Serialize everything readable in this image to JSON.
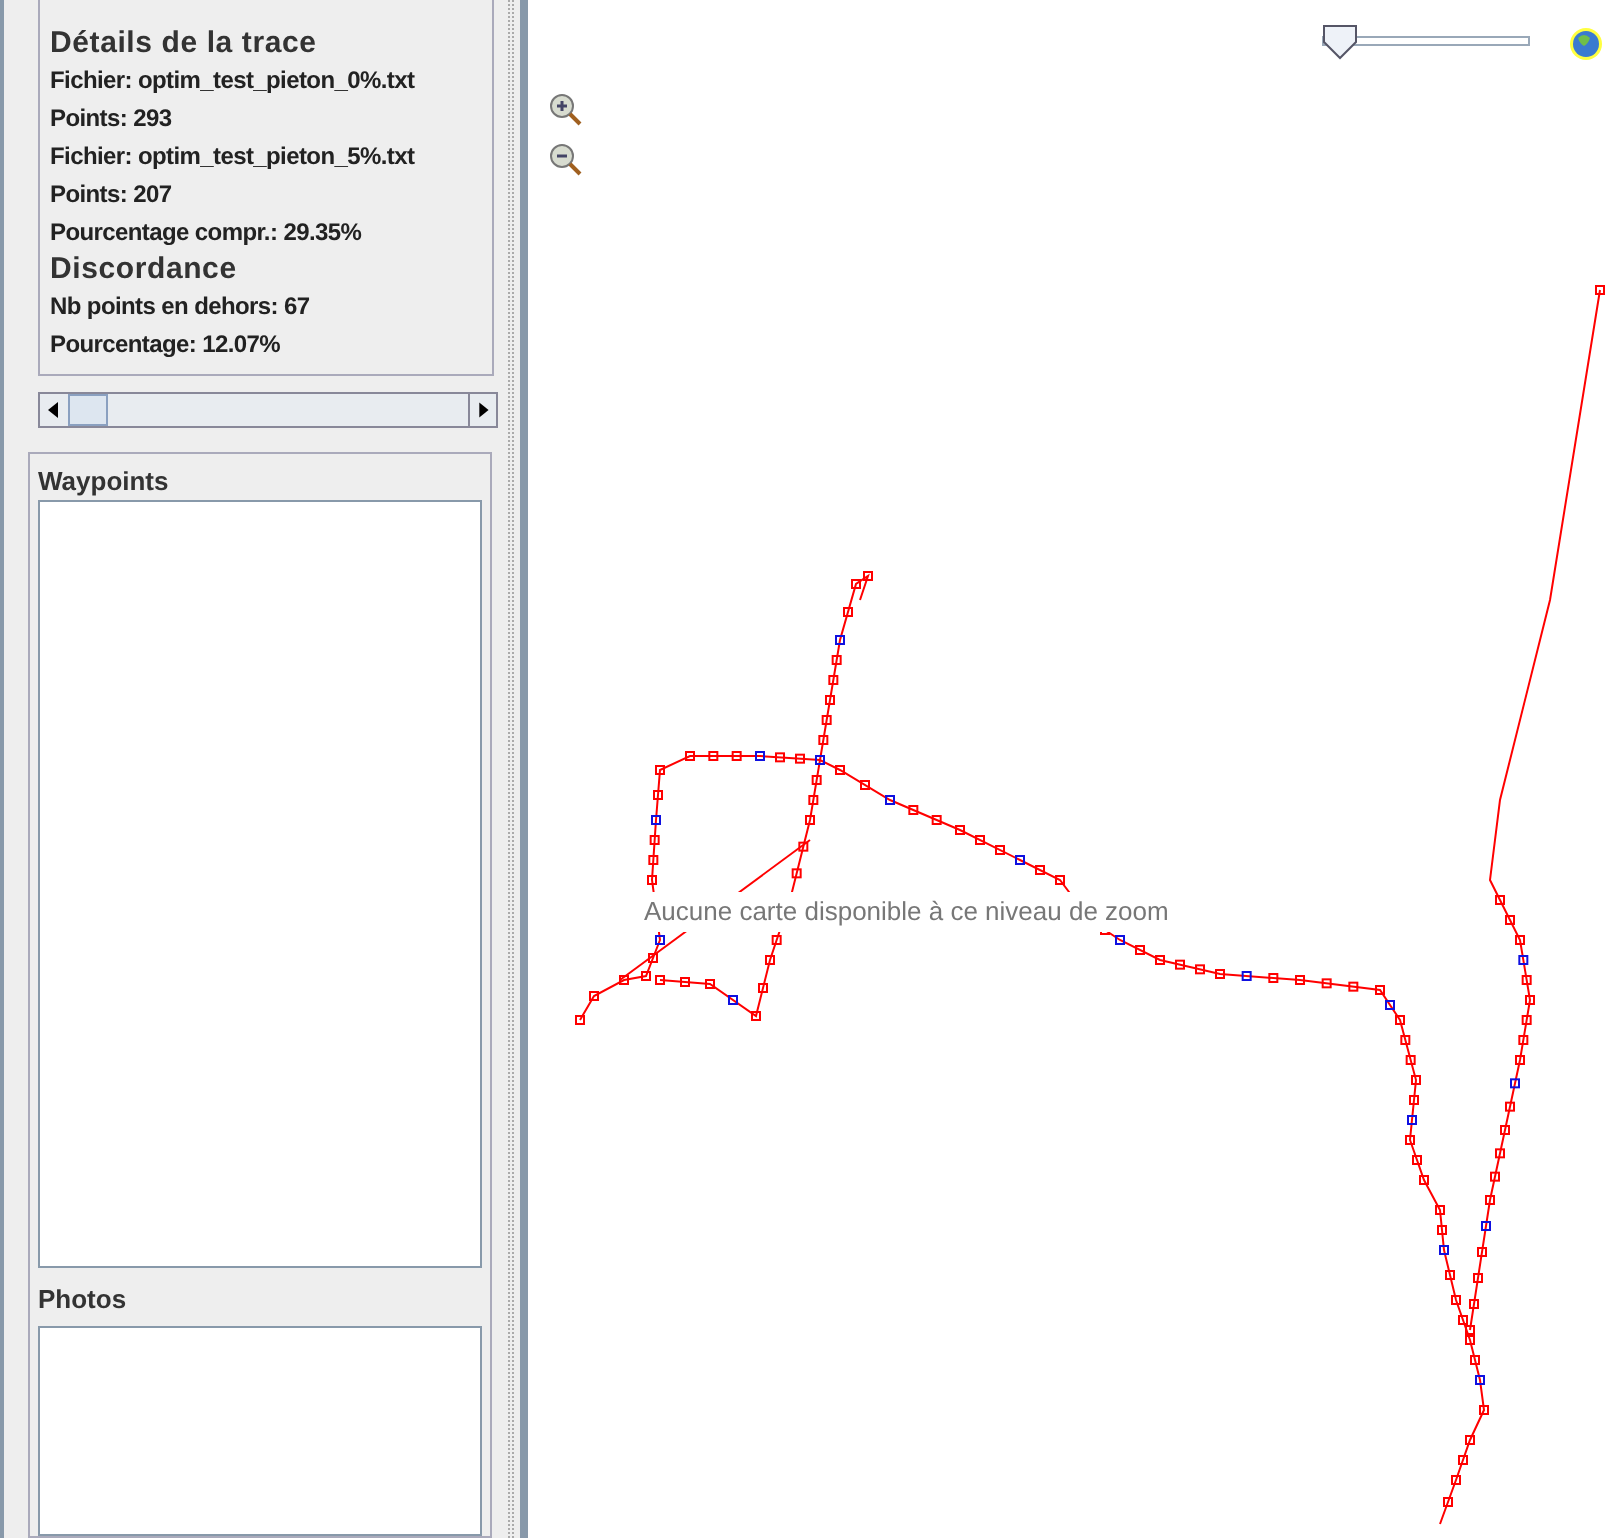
{
  "details": {
    "lines": [
      {
        "kind": "heading",
        "text": "Détails de la trace"
      },
      {
        "kind": "line",
        "text": "Fichier: optim_test_pieton_0%.txt"
      },
      {
        "kind": "line",
        "text": "Points: 293"
      },
      {
        "kind": "line",
        "text": "Fichier: optim_test_pieton_5%.txt"
      },
      {
        "kind": "line",
        "text": "Points: 207"
      },
      {
        "kind": "line",
        "text": "Pourcentage compr.: 29.35%"
      },
      {
        "kind": "heading",
        "text": "Discordance"
      },
      {
        "kind": "line",
        "text": "Nb points en dehors: 67"
      },
      {
        "kind": "line",
        "text": "Pourcentage: 12.07%"
      }
    ]
  },
  "waypoints": {
    "title": "Waypoints"
  },
  "photos": {
    "title": "Photos"
  },
  "map": {
    "message": "Aucune carte disponible à ce niveau de zoom",
    "zoom_slider": {
      "level": 0.04
    }
  }
}
